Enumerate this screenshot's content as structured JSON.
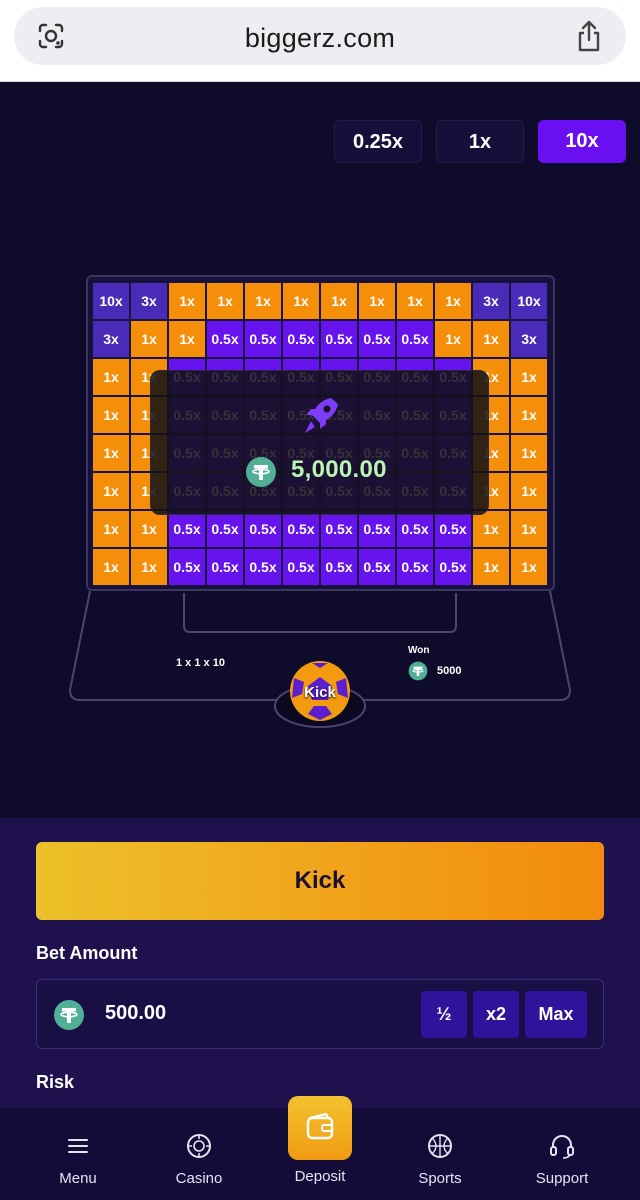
{
  "browser": {
    "url": "biggerz.com",
    "lens_icon": "google-lens-icon",
    "share_icon": "share-icon"
  },
  "multiplier_selector": {
    "options": [
      "0.25x",
      "1x",
      "10x"
    ],
    "selected": "10x"
  },
  "board": {
    "rows": [
      [
        "10x",
        "3x",
        "1x",
        "1x",
        "1x",
        "1x",
        "1x",
        "1x",
        "1x",
        "1x",
        "3x",
        "10x"
      ],
      [
        "3x",
        "1x",
        "1x",
        "0.5x",
        "0.5x",
        "0.5x",
        "0.5x",
        "0.5x",
        "0.5x",
        "1x",
        "1x",
        "3x"
      ],
      [
        "1x",
        "1x",
        "0.5x",
        "0.5x",
        "0.5x",
        "0.5x",
        "0.5x",
        "0.5x",
        "0.5x",
        "0.5x",
        "1x",
        "1x"
      ],
      [
        "1x",
        "1x",
        "0.5x",
        "0.5x",
        "0.5x",
        "0.5x",
        "0.5x",
        "0.5x",
        "0.5x",
        "0.5x",
        "1x",
        "1x"
      ],
      [
        "1x",
        "1x",
        "0.5x",
        "0.5x",
        "0.5x",
        "0.5x",
        "0.5x",
        "0.5x",
        "0.5x",
        "0.5x",
        "1x",
        "1x"
      ],
      [
        "1x",
        "1x",
        "0.5x",
        "0.5x",
        "0.5x",
        "0.5x",
        "0.5x",
        "0.5x",
        "0.5x",
        "0.5x",
        "1x",
        "1x"
      ],
      [
        "1x",
        "1x",
        "0.5x",
        "0.5x",
        "0.5x",
        "0.5x",
        "0.5x",
        "0.5x",
        "0.5x",
        "0.5x",
        "1x",
        "1x"
      ],
      [
        "1x",
        "1x",
        "0.5x",
        "0.5x",
        "0.5x",
        "0.5x",
        "0.5x",
        "0.5x",
        "0.5x",
        "0.5x",
        "1x",
        "1x"
      ]
    ],
    "colors": {
      "10x": "#4a2bb8",
      "3x": "#4a2bb8",
      "1x": "#f58e09",
      "0.5x": "#6613ee"
    }
  },
  "win_overlay": {
    "icon": "rocket-icon",
    "currency_icon": "tether-coin-icon",
    "amount": "5,000.00"
  },
  "field": {
    "multiplier_info": "1 x 1 x 10",
    "won_label": "Won",
    "won_value": "5000",
    "ball_label": "Kick"
  },
  "controls": {
    "kick_label": "Kick",
    "bet_amount_label": "Bet Amount",
    "bet_value": "500.00",
    "half_label": "½",
    "double_label": "x2",
    "max_label": "Max",
    "risk_label": "Risk"
  },
  "nav": {
    "items": [
      {
        "label": "Menu",
        "icon": "hamburger-icon"
      },
      {
        "label": "Casino",
        "icon": "casino-chip-icon"
      },
      {
        "label": "Deposit",
        "icon": "wallet-icon"
      },
      {
        "label": "Sports",
        "icon": "basketball-icon"
      },
      {
        "label": "Support",
        "icon": "headset-icon"
      }
    ]
  },
  "colors": {
    "background": "#0f0b2b",
    "accent_purple": "#6a0ff2",
    "kick_gradient_start": "#ecc12a",
    "kick_gradient_end": "#f28b0c",
    "win_text": "#b8f5b4"
  }
}
